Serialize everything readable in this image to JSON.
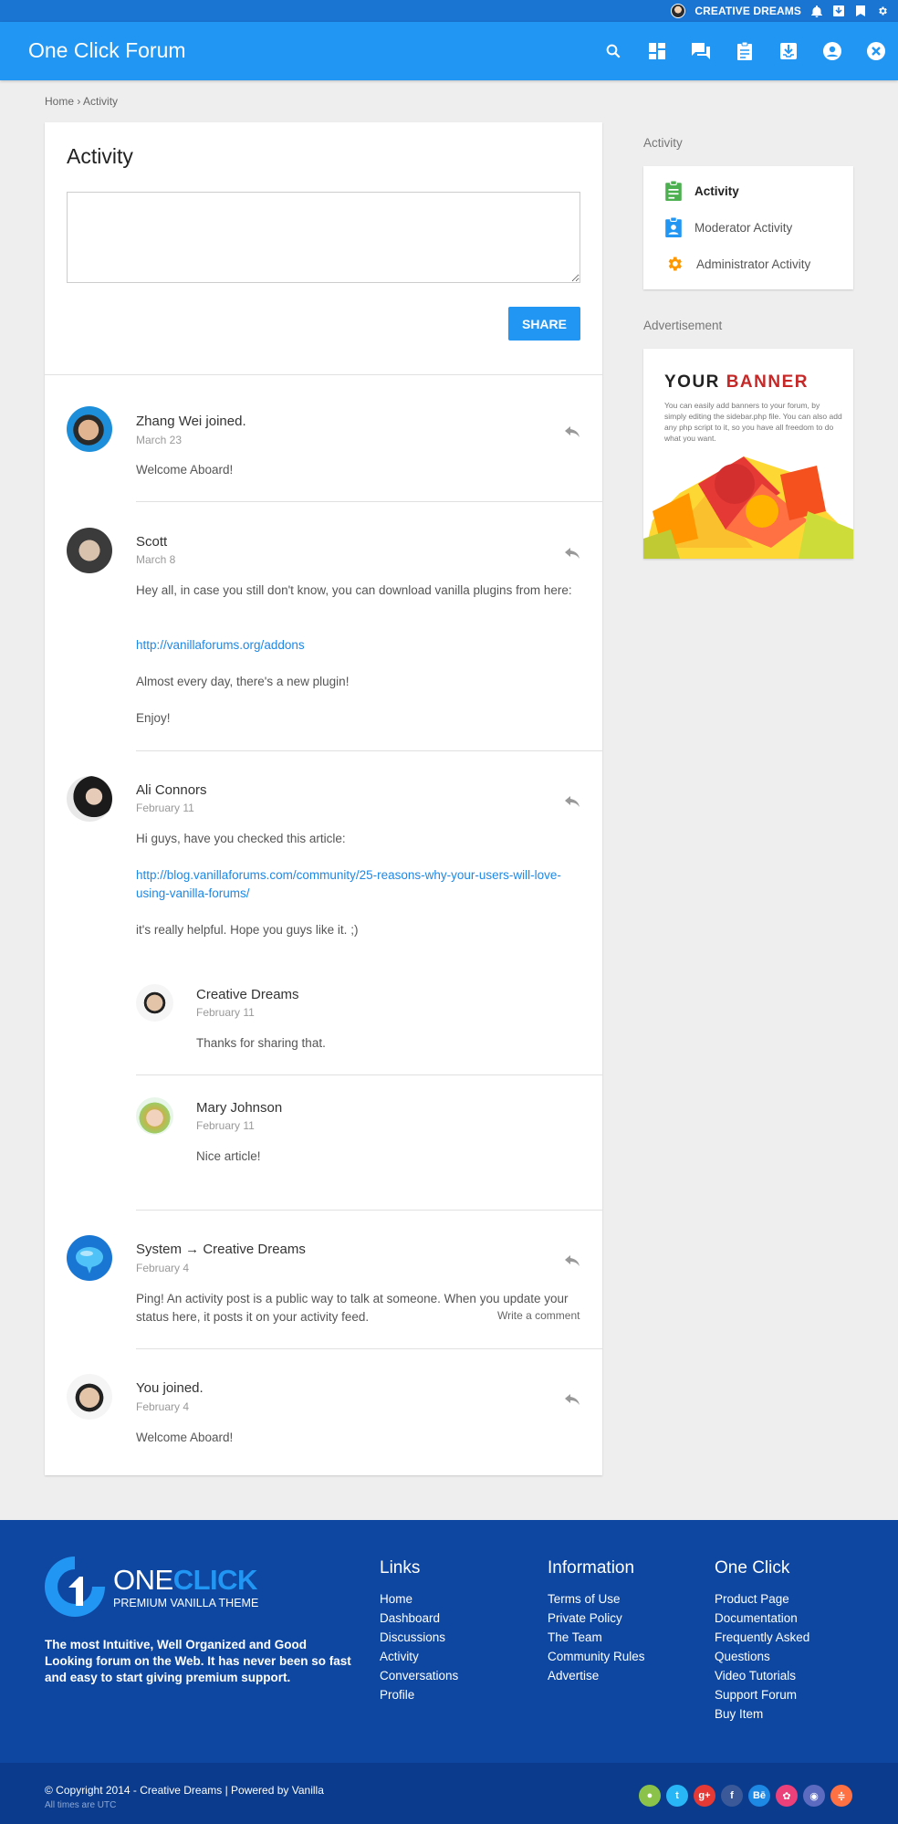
{
  "topbar": {
    "username": "CREATIVE DREAMS"
  },
  "header": {
    "title": "One Click Forum"
  },
  "breadcrumb": {
    "home": "Home",
    "separator": "›",
    "current": "Activity"
  },
  "main": {
    "title": "Activity",
    "textbox_placeholder": "",
    "share_label": "SHARE",
    "write_comment": "Write a comment"
  },
  "activities": [
    {
      "author": "Zhang Wei joined.",
      "date": "March 23",
      "lines": [
        "Welcome Aboard!"
      ]
    },
    {
      "author": "Scott",
      "date": "March 8",
      "p1": "Hey all, in case you still don't know, you can download vanilla plugins from here:",
      "link": "http://vanillaforums.org/addons",
      "p2": "Almost every day, there's a new plugin!",
      "p3": "Enjoy!"
    },
    {
      "author": "Ali Connors",
      "date": "February 11",
      "p1": "Hi guys, have you checked this article:",
      "link": "http://blog.vanillaforums.com/community/25-reasons-why-your-users-will-love-using-vanilla-forums/",
      "p2": "it's really helpful. Hope you guys like it. ;)",
      "comments": [
        {
          "author": "Creative Dreams",
          "date": "February 11",
          "text": "Thanks for sharing that."
        },
        {
          "author": "Mary Johnson",
          "date": "February 11",
          "text": "Nice article!"
        }
      ]
    },
    {
      "author": "System → Creative Dreams",
      "date": "February 4",
      "p1": "Ping! An activity post is a public way to talk at someone. When you update your status here, it posts it on your activity feed."
    },
    {
      "author": "You joined.",
      "date": "February 4",
      "p1": "Welcome Aboard!"
    }
  ],
  "sidebar": {
    "activity_heading": "Activity",
    "items": [
      {
        "label": "Activity",
        "icon": "clipboard-icon",
        "color": "#4caf50"
      },
      {
        "label": "Moderator Activity",
        "icon": "badge-icon",
        "color": "#2196f3"
      },
      {
        "label": "Administrator Activity",
        "icon": "gear-icon",
        "color": "#ff9800"
      }
    ],
    "ad_heading": "Advertisement",
    "banner": {
      "title_a": "YOUR",
      "title_b": "BANNER",
      "text": "You can easily add banners to your forum, by simply editing the sidebar.php file. You can also add any php script to it, so you have all freedom to do what you want."
    }
  },
  "footer": {
    "logo_one": "ONE",
    "logo_click": "CLICK",
    "logo_sub": "PREMIUM VANILLA THEME",
    "description": "The most Intuitive, Well Organized and Good Looking forum on the Web. It has never been so fast and easy to start giving premium support.",
    "links": {
      "title": "Links",
      "items": [
        "Home",
        "Dashboard",
        "Discussions",
        "Activity",
        "Conversations",
        "Profile"
      ]
    },
    "information": {
      "title": "Information",
      "items": [
        "Terms of Use",
        "Private Policy",
        "The Team",
        "Community Rules",
        "Advertise"
      ]
    },
    "oneclick": {
      "title": "One Click",
      "items": [
        "Product Page",
        "Documentation",
        "Frequently Asked Questions",
        "Video Tutorials",
        "Support Forum",
        "Buy Item"
      ]
    },
    "copyright": "© Copyright 2014 - Creative Dreams | Powered by Vanilla",
    "times": "All times are UTC"
  },
  "colors": {
    "primary": "#2196f3",
    "topbar": "#1a74d2",
    "footer": "#0d47a1",
    "link": "#1e88e5"
  }
}
